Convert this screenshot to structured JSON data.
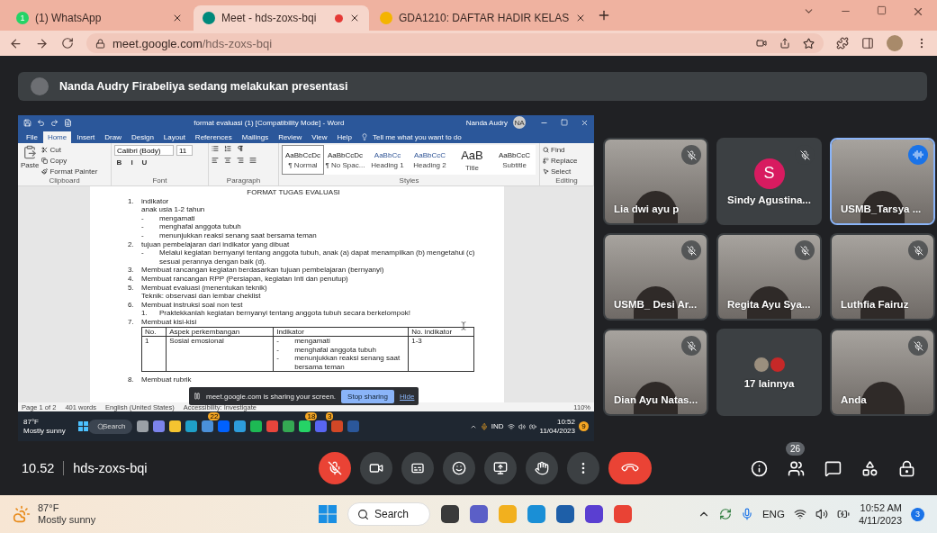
{
  "browser": {
    "tabs": [
      {
        "title": "(1) WhatsApp",
        "selected": false,
        "badge": "1",
        "recording": false
      },
      {
        "title": "Meet - hds-zoxs-bqi",
        "selected": true,
        "recording": true
      },
      {
        "title": "GDA1210: DAFTAR HADIR KELAS",
        "selected": false,
        "recording": false
      }
    ],
    "url": {
      "host": "meet.google.com",
      "path": "/hds-zoxs-bqi"
    }
  },
  "meet": {
    "banner": "Nanda Audry Firabeliya sedang melakukan presentasi",
    "word": {
      "title": "format evaluasi (1) [Compatibility Mode]  -  Word",
      "user": "Nanda Audry",
      "user_initials": "NA",
      "menu": [
        {
          "label": "File",
          "selected": false
        },
        {
          "label": "Home",
          "selected": true
        },
        {
          "label": "Insert",
          "selected": false
        },
        {
          "label": "Draw",
          "selected": false
        },
        {
          "label": "Design",
          "selected": false
        },
        {
          "label": "Layout",
          "selected": false
        },
        {
          "label": "References",
          "selected": false
        },
        {
          "label": "Mailings",
          "selected": false
        },
        {
          "label": "Review",
          "selected": false
        },
        {
          "label": "View",
          "selected": false
        },
        {
          "label": "Help",
          "selected": false
        }
      ],
      "tell_me": "Tell me what you want to do",
      "clipboard": {
        "paste": "Paste",
        "cut": "Cut",
        "copy": "Copy",
        "painter": "Format Painter",
        "label": "Clipboard"
      },
      "font": {
        "family": "Calibri (Body)",
        "size": "11",
        "buttons": [
          "B",
          "I",
          "U"
        ],
        "label": "Font"
      },
      "paragraph": {
        "label": "Paragraph"
      },
      "styles": {
        "items": [
          {
            "preview": "AaBbCcDc",
            "name": "¶ Normal",
            "selected": true
          },
          {
            "preview": "AaBbCcDc",
            "name": "¶ No Spac...",
            "selected": false
          },
          {
            "preview": "AaBbCc",
            "name": "Heading 1",
            "selected": false
          },
          {
            "preview": "AaBbCcC",
            "name": "Heading 2",
            "selected": false
          },
          {
            "preview": "AaB",
            "name": "Title",
            "selected": false
          },
          {
            "preview": "AaBbCcC",
            "name": "Subtitle",
            "selected": false
          }
        ],
        "label": "Styles"
      },
      "editing": {
        "find": "Find",
        "replace": "Replace",
        "select": "Select",
        "label": "Editing"
      },
      "document": {
        "heading": "FORMAT TUGAS EVALUASI",
        "bullet_mark": "-",
        "items": [
          {
            "number": "1.",
            "text": "indikator",
            "lines": [
              "anak usia 1-2 tahun"
            ],
            "bullets": [
              "mengamati",
              "menghafal anggota tubuh",
              "menunjukkan reaksi senang saat bersama teman"
            ]
          },
          {
            "number": "2.",
            "text": "tujuan pembelajaran dari indikator yang dibuat",
            "bullets": [
              "Melalui kegiatan bernyanyi tentang anggota tubuh, anak (a) dapat menampilkan (b) mengetahui (c) sesuai perannya dengan baik (d)."
            ]
          },
          {
            "number": "3.",
            "text": "Membuat rancangan kegiatan berdasarkan tujuan pembelajaran (bernyanyi)"
          },
          {
            "number": "4.",
            "text": "Membuat rancangan RPP (Persiapan, kegiatan Inti dan penutup)"
          },
          {
            "number": "5.",
            "text": "Membuat evaluasi (menentukan teknik)",
            "lines": [
              "Teknik: observasi dan lembar cheklist"
            ]
          },
          {
            "number": "6.",
            "text": "Membuat instruksi soal non test",
            "subitems": [
              {
                "number": "1.",
                "text": "Praktekkanlah kegiatan bernyanyi tentang anggota tubuh secara berkelompok!"
              }
            ]
          },
          {
            "number": "7.",
            "text": "Membuat kisi-kisi",
            "table": {
              "columns": [
                "No.",
                "Aspek perkembangan",
                "Indikator",
                "No. indikator"
              ],
              "rows": [
                {
                  "no": "1",
                  "aspect": "Sosial emosional",
                  "indicators": [
                    "mengamati",
                    "menghafal anggota tubuh",
                    "menunjukkan reaksi senang saat bersama teman"
                  ],
                  "indicator_no": "1-3"
                }
              ]
            }
          },
          {
            "number": "8.",
            "text": "Membuat rubrik"
          }
        ]
      },
      "status": [
        "Page 1 of 2",
        "401 words",
        "English (United States)",
        "Accessibility: Investigate"
      ],
      "zoom": "110%"
    },
    "share_notice": {
      "text": "meet.google.com is sharing your screen.",
      "stop": "Stop sharing",
      "hide": "Hide"
    },
    "inner_taskbar": {
      "temp": "87°F",
      "weather": "Mostly sunny",
      "search": "Search",
      "apps": [
        {
          "color": "#9aa0a6"
        },
        {
          "color": "#7b83eb"
        },
        {
          "color": "#f4c430"
        },
        {
          "color": "#1fa0c8"
        },
        {
          "color": "#4a90d9",
          "badge": "22"
        },
        {
          "color": "#0061fe"
        },
        {
          "color": "#2d9cdb"
        },
        {
          "color": "#1db954"
        },
        {
          "color": "#e8453c"
        },
        {
          "color": "#34a853"
        },
        {
          "color": "#25d366",
          "badge": "18"
        },
        {
          "color": "#5865f2",
          "badge": "3"
        },
        {
          "color": "#d24726"
        },
        {
          "color": "#2b579a"
        }
      ],
      "lang": "IND",
      "time": "10:52",
      "date": "11/04/2023",
      "badge": "9"
    },
    "tiles": [
      {
        "name": "Lia dwi ayu p",
        "kind": "video",
        "muted": true,
        "speaking": false
      },
      {
        "name": "Sindy Agustina...",
        "kind": "avatar",
        "initial": "S",
        "color": "#d81b60",
        "muted": true,
        "speaking": false
      },
      {
        "name": "USMB_Tarsya ...",
        "kind": "video",
        "muted": false,
        "speaking": true
      },
      {
        "name": "USMB_ Desi Ar...",
        "kind": "video",
        "muted": true,
        "speaking": false
      },
      {
        "name": "Regita Ayu Sya...",
        "kind": "video",
        "muted": true,
        "speaking": false
      },
      {
        "name": "Luthfia Fairuz",
        "kind": "video",
        "muted": true,
        "speaking": false
      },
      {
        "name": "Dian Ayu Natas...",
        "kind": "video",
        "muted": true,
        "speaking": false
      },
      {
        "name": "17 lainnya",
        "kind": "others",
        "muted": false,
        "speaking": false
      },
      {
        "name": "Anda",
        "kind": "video",
        "muted": true,
        "speaking": false
      }
    ],
    "bar": {
      "time": "10.52",
      "code": "hds-zoxs-bqi",
      "mic_muted": true,
      "people_count": "26"
    }
  },
  "taskbar": {
    "temp": "87°F",
    "weather": "Mostly sunny",
    "search": "Search",
    "apps": [
      {
        "color": "#3a3a3a"
      },
      {
        "color": "#5b5fc7"
      },
      {
        "color": "#f2b01e"
      },
      {
        "color": "#1a8fd6"
      },
      {
        "color": "#1e5fa8"
      },
      {
        "color": "#5a3fd1"
      },
      {
        "color": "#e94335"
      }
    ],
    "lang": "ENG",
    "time": "10:52 AM",
    "date": "4/11/2023",
    "notifications": "3"
  }
}
